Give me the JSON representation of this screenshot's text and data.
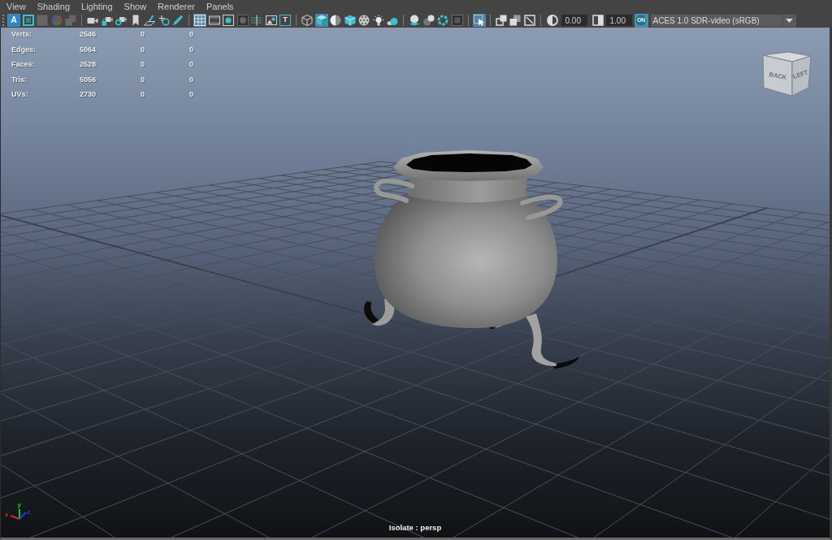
{
  "menu": [
    "View",
    "Shading",
    "Lighting",
    "Show",
    "Renderer",
    "Panels"
  ],
  "toolbar": {
    "groups": [
      [
        {
          "kind": "letter_fill",
          "label": "A",
          "on": true,
          "disabled": false
        },
        {
          "kind": "frame",
          "on": false,
          "disabled": false
        },
        {
          "kind": "square",
          "on": false,
          "disabled": true
        },
        {
          "kind": "segmented_circle",
          "on": false,
          "disabled": true
        },
        {
          "kind": "layers",
          "on": false,
          "disabled": true
        }
      ],
      [
        {
          "kind": "camera",
          "on": false,
          "disabled": false
        },
        {
          "kind": "camera_lock",
          "on": false,
          "disabled": false
        },
        {
          "kind": "camera_ring",
          "on": false,
          "disabled": false
        },
        {
          "kind": "bookmark",
          "on": false,
          "disabled": false
        },
        {
          "kind": "sheet_pen",
          "on": false,
          "disabled": false
        },
        {
          "kind": "magnifier",
          "on": false,
          "disabled": false
        },
        {
          "kind": "pencil",
          "on": false,
          "disabled": false
        }
      ],
      [
        {
          "kind": "grid",
          "on": true,
          "disabled": false
        },
        {
          "kind": "filmstrip",
          "on": false,
          "disabled": false
        },
        {
          "kind": "circle_square",
          "on": false,
          "disabled": false
        },
        {
          "kind": "dark_circle",
          "on": false,
          "disabled": true
        },
        {
          "kind": "dotted_lines",
          "on": false,
          "disabled": false
        },
        {
          "kind": "picture",
          "on": false,
          "disabled": false
        },
        {
          "kind": "letter_box",
          "label": "T",
          "on": false,
          "disabled": false
        }
      ],
      [
        {
          "kind": "wire_cube",
          "on": false,
          "disabled": false
        },
        {
          "kind": "shaded_cube",
          "on": true,
          "disabled": false
        },
        {
          "kind": "half_sphere",
          "on": false,
          "disabled": false
        },
        {
          "kind": "outlined_cube",
          "on": false,
          "disabled": false
        },
        {
          "kind": "checker_sphere",
          "on": false,
          "disabled": false
        },
        {
          "kind": "light_bulb",
          "on": false,
          "disabled": false
        },
        {
          "kind": "ball_shadow",
          "on": false,
          "disabled": false
        }
      ],
      [
        {
          "kind": "sphere_plane",
          "on": false,
          "disabled": false
        },
        {
          "kind": "two_spheres",
          "on": false,
          "disabled": false
        },
        {
          "kind": "dashed_ring",
          "on": false,
          "disabled": false
        },
        {
          "kind": "dark_square",
          "on": false,
          "disabled": true
        }
      ],
      [
        {
          "kind": "cursor_select",
          "on": true,
          "disabled": false
        }
      ],
      [
        {
          "kind": "overlap_squares",
          "on": false,
          "disabled": false
        },
        {
          "kind": "stacked_squares",
          "on": false,
          "disabled": false
        },
        {
          "kind": "diagonal_square",
          "on": false,
          "disabled": false
        }
      ]
    ],
    "color_management": {
      "exposure": "0.00",
      "gamma": "1.00",
      "toggle": {
        "label": "ON",
        "on": true
      },
      "view_transform": "ACES 1.0 SDR-video (sRGB)"
    }
  },
  "stats": [
    {
      "label": "Verts:",
      "values": [
        "2546",
        "0",
        "0"
      ]
    },
    {
      "label": "Edges:",
      "values": [
        "5064",
        "0",
        "0"
      ]
    },
    {
      "label": "Faces:",
      "values": [
        "2528",
        "0",
        "0"
      ]
    },
    {
      "label": "Tris:",
      "values": [
        "5056",
        "0",
        "0"
      ]
    },
    {
      "label": "UVs:",
      "values": [
        "2730",
        "0",
        "0"
      ]
    }
  ],
  "view_cube": {
    "front_label": "BACK",
    "side_label": "LEFT"
  },
  "axes": [
    {
      "label": "x",
      "color": "#d42a2a"
    },
    {
      "label": "y",
      "color": "#1ec81e"
    },
    {
      "label": "z",
      "color": "#2a3ce0"
    }
  ],
  "camera_label": "Isolate : persp"
}
